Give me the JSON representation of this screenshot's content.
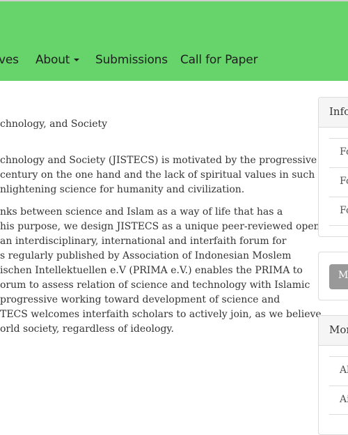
{
  "nav": {
    "items": [
      {
        "label": "ves"
      },
      {
        "label": "About"
      },
      {
        "label": "Submissions"
      },
      {
        "label": "Call for Paper"
      }
    ]
  },
  "main": {
    "journal_name_fragment": "chnology, and Society",
    "paragraph1": [
      "chnology and Society (JISTECS) is motivated by the progressive",
      "century on the one hand and the lack of spiritual values in such",
      "nlightening science for humanity and civilization."
    ],
    "paragraph2": [
      "nks between science and Islam as a way of life that has a",
      "his purpose, we design JISTECS as a unique peer-reviewed open",
      "an interdisciplinary, international and interfaith forum for",
      "s regularly published by Association of Indonesian Moslem",
      "ischen Intellektuellen e.V (PRIMA e.V.) enables the PRIMA to",
      "orum to assess relation of science and technology with Islamic",
      "progressive working toward development of science and",
      "TECS welcomes interfaith scholars to actively join, as we believe",
      "orld society, regardless of ideology."
    ]
  },
  "sidebar": {
    "info_title": "Info",
    "info_links": [
      "Fo",
      "Fo",
      "Fo"
    ],
    "button_label": "M",
    "more_title": "Mor",
    "more_links": [
      "Al",
      "Ai"
    ]
  },
  "colors": {
    "header_bg": "#66d36b",
    "button_gray": "#999999"
  }
}
